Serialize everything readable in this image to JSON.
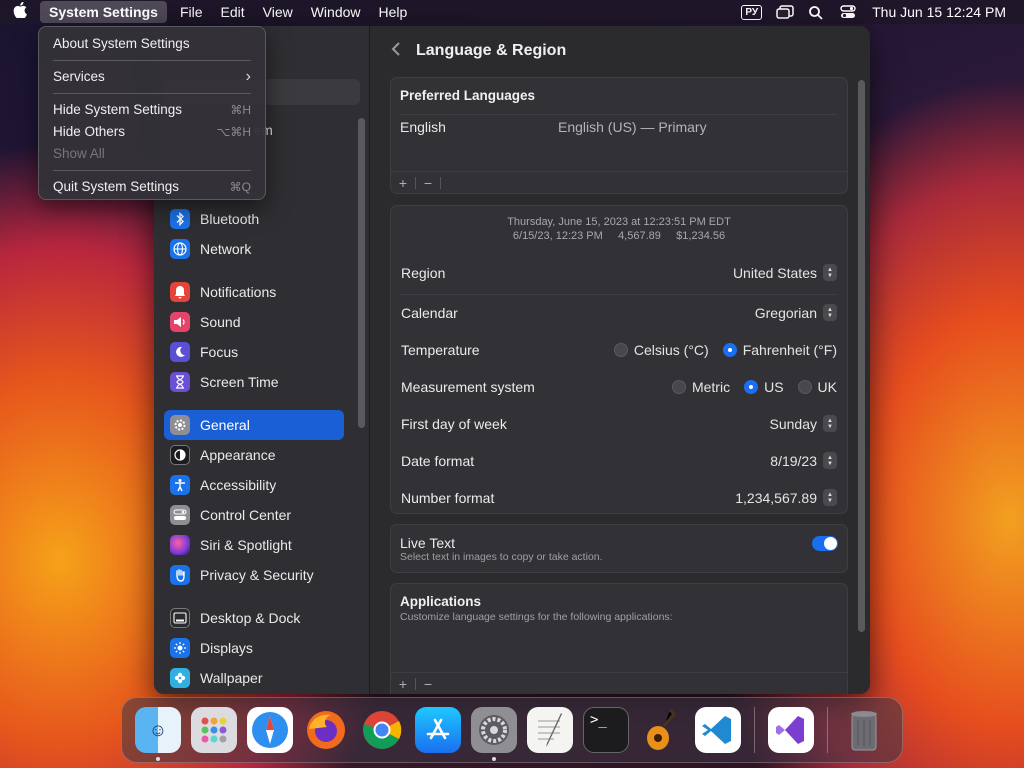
{
  "menubar": {
    "app_name": "System Settings",
    "menus": [
      "File",
      "Edit",
      "View",
      "Window",
      "Help"
    ],
    "input_source": "РУ",
    "clock": "Thu Jun 15  12:24 PM"
  },
  "app_menu": {
    "items": [
      {
        "label": "About System Settings",
        "shortcut": ""
      },
      {
        "label": "Services",
        "shortcut": "›"
      },
      {
        "label": "Hide System Settings",
        "shortcut": "⌘H"
      },
      {
        "label": "Hide Others",
        "shortcut": "⌥⌘H"
      },
      {
        "label": "Show All",
        "shortcut": ""
      },
      {
        "label": "Quit System Settings",
        "shortcut": "⌘Q"
      }
    ]
  },
  "sidebar": {
    "partial_label": "em",
    "items": [
      {
        "label": "Bluetooth",
        "icon": "bluetooth-icon",
        "color": "#1a73e8"
      },
      {
        "label": "Network",
        "icon": "globe-icon",
        "color": "#1a73e8"
      },
      {
        "label": "Notifications",
        "icon": "bell-icon",
        "color": "#e5443a"
      },
      {
        "label": "Sound",
        "icon": "speaker-icon",
        "color": "#e5446a"
      },
      {
        "label": "Focus",
        "icon": "moon-icon",
        "color": "#5b4fd6"
      },
      {
        "label": "Screen Time",
        "icon": "hourglass-icon",
        "color": "#6b4fd6"
      },
      {
        "label": "General",
        "icon": "gear-icon",
        "color": "#8e8e93"
      },
      {
        "label": "Appearance",
        "icon": "appearance-icon",
        "color": "#1c1c1e"
      },
      {
        "label": "Accessibility",
        "icon": "accessibility-icon",
        "color": "#1a73e8"
      },
      {
        "label": "Control Center",
        "icon": "toggles-icon",
        "color": "#8e8e93"
      },
      {
        "label": "Siri & Spotlight",
        "icon": "siri-icon",
        "color": "#b045d8"
      },
      {
        "label": "Privacy & Security",
        "icon": "hand-icon",
        "color": "#1a73e8"
      },
      {
        "label": "Desktop & Dock",
        "icon": "dock-icon",
        "color": "#2c2c2e"
      },
      {
        "label": "Displays",
        "icon": "sun-icon",
        "color": "#1a73e8"
      },
      {
        "label": "Wallpaper",
        "icon": "flower-icon",
        "color": "#30b0e0"
      }
    ]
  },
  "content": {
    "title": "Language & Region",
    "preferred_languages": {
      "heading": "Preferred Languages",
      "language": "English",
      "detail": "English (US) — Primary"
    },
    "preview": {
      "line1": "Thursday, June 15, 2023 at 12:23:51 PM EDT",
      "line2": "6/15/23, 12:23 PM     4,567.89     $1,234.56"
    },
    "settings": {
      "region": {
        "label": "Region",
        "value": "United States"
      },
      "calendar": {
        "label": "Calendar",
        "value": "Gregorian"
      },
      "temperature": {
        "label": "Temperature",
        "options": [
          "Celsius (°C)",
          "Fahrenheit (°F)"
        ],
        "selected": "Fahrenheit (°F)"
      },
      "measurement": {
        "label": "Measurement system",
        "options": [
          "Metric",
          "US",
          "UK"
        ],
        "selected": "US"
      },
      "first_day": {
        "label": "First day of week",
        "value": "Sunday"
      },
      "date_format": {
        "label": "Date format",
        "value": "8/19/23"
      },
      "number_format": {
        "label": "Number format",
        "value": "1,234,567.89"
      }
    },
    "live_text": {
      "label": "Live Text",
      "description": "Select text in images to copy or take action.",
      "enabled": true
    },
    "applications": {
      "heading": "Applications",
      "description": "Customize language settings for the following applications:"
    },
    "add_symbol": "+",
    "remove_symbol": "−"
  },
  "dock": {
    "apps": [
      "Finder",
      "Launchpad",
      "Safari",
      "Firefox",
      "Chrome",
      "App Store",
      "System Settings",
      "TextEdit",
      "Terminal",
      "GarageBand",
      "Visual Studio Code",
      "Visual Studio",
      "Trash"
    ],
    "running": [
      "Finder",
      "System Settings"
    ]
  },
  "colors": {
    "accent": "#1a6ff0",
    "sidebar_selected": "#1a5fd6",
    "window_bg": "#2b2b2e"
  }
}
